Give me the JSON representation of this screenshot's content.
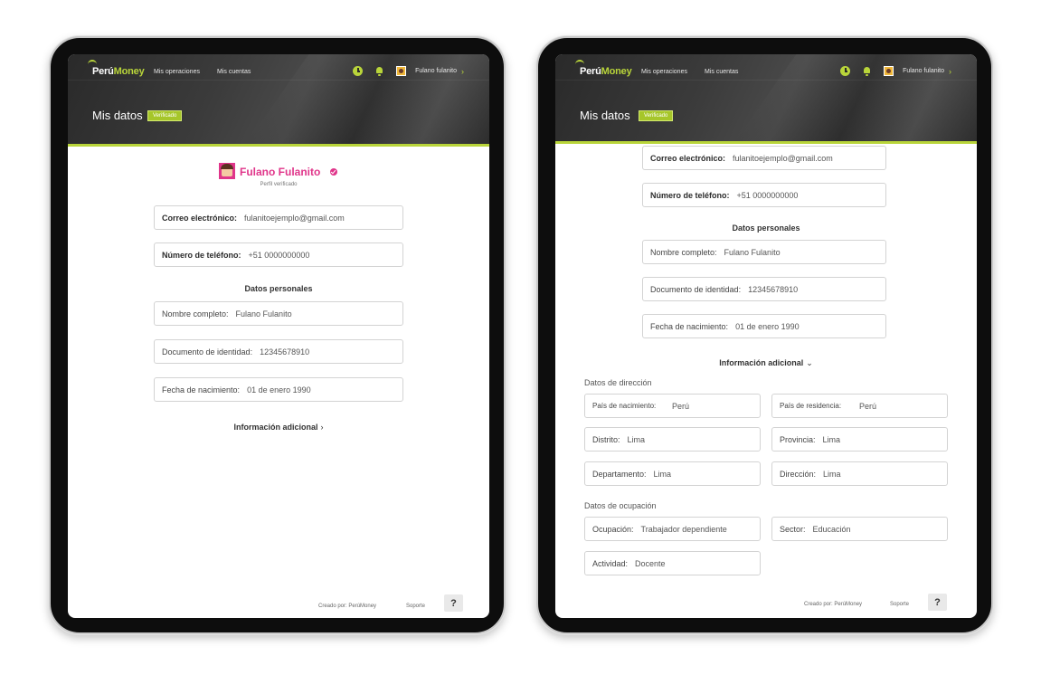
{
  "header": {
    "logo_main": "Perú",
    "logo_accent": "Money",
    "nav_operations": "Mis operaciones",
    "nav_accounts": "Mis cuentas",
    "user_name": "Fulano fulanito",
    "page_title": "Mis datos",
    "badge": "Verificado",
    "accent_color": "#b9d53a"
  },
  "profile": {
    "name": "Fulano Fulanito",
    "status": "Perfil verificado",
    "accent_color": "#e0358a"
  },
  "contact": {
    "email_label": "Correo electrónico:",
    "email_value": "fulanitoejemplo@gmail.com",
    "phone_label": "Número de teléfono:",
    "phone_value": "+51 0000000000"
  },
  "personal": {
    "title": "Datos personales",
    "name_label": "Nombre completo:",
    "name_value": "Fulano Fulanito",
    "doc_label": "Documento de identidad:",
    "doc_value": "12345678910",
    "birth_label": "Fecha de nacimiento:",
    "birth_value": "01 de enero 1990"
  },
  "additional": {
    "title": "Información adicional",
    "address_title": "Datos de dirección",
    "birth_country_label": "País de nacimiento:",
    "birth_country_value": "Perú",
    "residence_country_label": "País de residencia:",
    "residence_country_value": "Perú",
    "district_label": "Distrito:",
    "district_value": "Lima",
    "province_label": "Provincia:",
    "province_value": "Lima",
    "department_label": "Departamento:",
    "department_value": "Lima",
    "address_label": "Dirección:",
    "address_value": "Lima",
    "occupation_title": "Datos de ocupación",
    "occupation_label": "Ocupación:",
    "occupation_value": "Trabajador dependiente",
    "sector_label": "Sector:",
    "sector_value": "Educación",
    "activity_label": "Actividad:",
    "activity_value": "Docente"
  },
  "footer": {
    "created_by": "Creado por: PerúMoney",
    "support": "Soporte",
    "help": "?"
  },
  "icons": [
    "clock-icon",
    "bell-icon",
    "chevron-right-icon",
    "chevron-down-icon",
    "verified-icon",
    "avatar"
  ]
}
